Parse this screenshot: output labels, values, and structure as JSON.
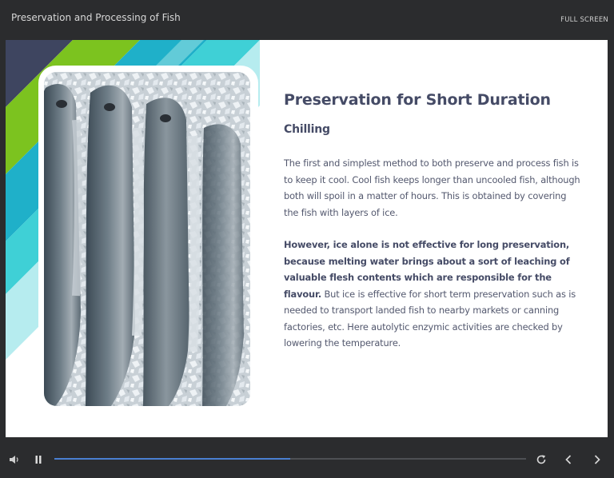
{
  "app": {
    "title": "Preservation and Processing of Fish",
    "fullscreen_label": "FULL SCREEN"
  },
  "slide": {
    "heading": "Preservation for Short Duration",
    "subheading": "Chilling",
    "paragraph1": "The first and simplest method to both preserve and process fish is to keep it cool. Cool fish keeps longer than uncooled fish, although both will spoil in a matter of hours. This is obtained by covering the fish with layers of ice.",
    "paragraph2_bold": "However, ice alone is not effective for long preservation, because melting water brings about a sort of leaching of valuable flesh contents which are responsible for the flavour.",
    "paragraph2_rest": " But ice is effective for short term preservation such as is needed to transport landed fish to nearby markets or canning factories, etc. Here autolytic enzymic activities are checked by lowering the temperature."
  },
  "player": {
    "progress": 0.5,
    "icons": [
      "volume-icon",
      "pause-icon",
      "replay-icon",
      "prev-icon",
      "next-icon"
    ]
  },
  "colors": {
    "chrome": "#2b2c2e",
    "heading": "#454b66",
    "progress": "#4a7fd1",
    "deco_navy": "#3e4560",
    "deco_green": "#7cc31f",
    "deco_blue": "#1fb0c9",
    "deco_teal": "#3fd0d6",
    "deco_aqua": "#b6ecef"
  }
}
